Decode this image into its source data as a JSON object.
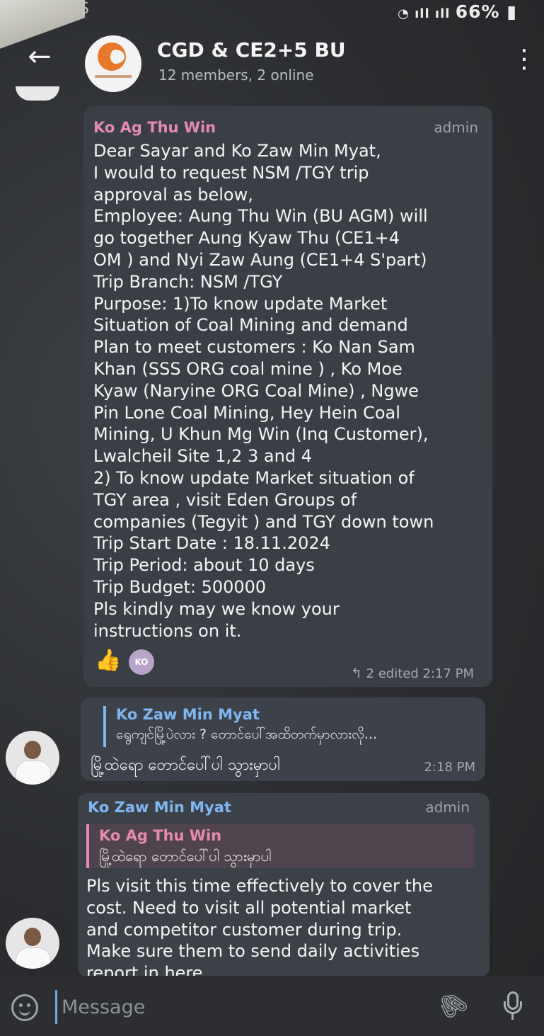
{
  "status_bar": {
    "right_text": "66%",
    "left_glyph": "S"
  },
  "header": {
    "back_icon": "←",
    "title": "CGD & CE2+5 BU",
    "subtitle": "12 members, 2 online",
    "menu_icon": "⋮"
  },
  "messages": [
    {
      "sender": "Ko Ag Thu Win",
      "role": "admin",
      "lines": [
        "Dear Sayar and Ko Zaw Min Myat,",
        "I would to request NSM /TGY trip",
        "approval as below,",
        "Employee: Aung Thu Win (BU AGM) will",
        "go together Aung Kyaw Thu (CE1+4",
        "OM ) and Nyi Zaw Aung (CE1+4 S'part)",
        "Trip Branch: NSM /TGY",
        "Purpose: 1)To know update Market",
        "Situation of Coal Mining and demand",
        "Plan to meet customers : Ko Nan Sam",
        "Khan (SSS ORG coal mine ) , Ko Moe",
        "Kyaw (Naryine ORG Coal Mine) , Ngwe",
        "Pin Lone Coal Mining, Hey Hein Coal",
        "Mining, U Khun Mg Win (Inq Customer),",
        "Lwalcheil Site 1,2 3 and 4",
        "2) To know update Market situation of",
        "TGY area , visit Eden Groups of",
        "companies (Tegyit ) and TGY down town",
        "Trip Start Date : 18.11.2024",
        "Trip Period: about 10 days",
        "Trip Budget: 500000",
        "Pls kindly may we know your",
        "instructions on it."
      ],
      "reaction_emoji": "👍",
      "reaction_avatar_label": "KO",
      "meta_icon": "↰",
      "meta_text": "2 edited 2:17 PM"
    },
    {
      "quote_name": "Ko Zaw Min Myat",
      "quote_text": "ရွေကျင်မြို့ပဲလား ? တောင်ပေါ်အထိတက်မှာလားလို...",
      "text": "မြို့ထဲရော တောင်ပေါ်ပါ သွားမှာပါ",
      "time": "2:18 PM"
    },
    {
      "sender": "Ko Zaw Min Myat",
      "role": "admin",
      "quote_name": "Ko Ag Thu Win",
      "quote_text": "မြို့ထဲရော တောင်ပေါ်ပါ သွားမှာပါ",
      "lines": [
        "Pls visit this time effectively to cover the",
        "cost. Need to visit all potential market",
        "and competitor customer during trip.",
        "Make sure them to send daily activities",
        "report in here"
      ]
    }
  ],
  "input": {
    "placeholder": "Message"
  },
  "icons": {
    "back": "arrow-left-icon",
    "menu": "more-vertical-icon",
    "emoji": "smile-icon",
    "attach": "paperclip-icon",
    "mic": "microphone-icon"
  }
}
